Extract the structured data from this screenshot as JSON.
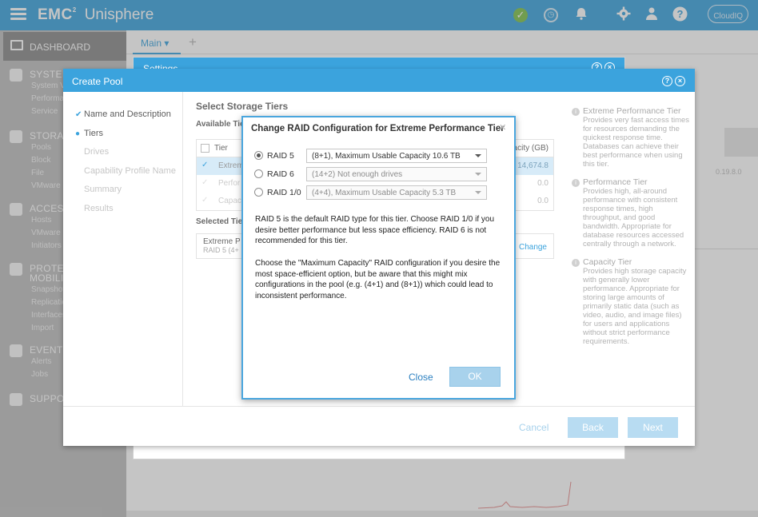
{
  "topbar": {
    "brand_emc": "EMC",
    "brand_sup": "2",
    "brand_product": "Unisphere",
    "cloudiq_label": "CloudIQ"
  },
  "sidebar": {
    "dashboard": "DASHBOARD",
    "sections": [
      {
        "head": "SYSTEM",
        "items": [
          "System V",
          "Performa",
          "Service"
        ]
      },
      {
        "head": "STORAG",
        "items": [
          "Pools",
          "Block",
          "File",
          "VMware"
        ]
      },
      {
        "head": "ACCESS",
        "items": [
          "Hosts",
          "VMware",
          "Initiators"
        ]
      },
      {
        "head": "PROTEC",
        "head2": "MOBILIT",
        "items": [
          "Snapshot",
          "Replicatio",
          "Interfaces",
          "Import"
        ]
      },
      {
        "head": "EVENTS",
        "items": [
          "Alerts",
          "Jobs"
        ]
      },
      {
        "head": "SUPPO",
        "items": []
      }
    ]
  },
  "main": {
    "tab_label": "Main",
    "add_tab": "+",
    "bg_number": "0.19.8.0"
  },
  "settings": {
    "title": "Settings"
  },
  "create_pool": {
    "title": "Create Pool",
    "steps": [
      {
        "label": "Name and Description",
        "state": "done"
      },
      {
        "label": "Tiers",
        "state": "active"
      },
      {
        "label": "Drives",
        "state": "pending"
      },
      {
        "label": "Capability Profile Name",
        "state": "pending"
      },
      {
        "label": "Summary",
        "state": "pending"
      },
      {
        "label": "Results",
        "state": "pending"
      }
    ],
    "section_title": "Select Storage Tiers",
    "available_label": "Available Tie",
    "table_header_tier": "Tier",
    "table_header_capacity": "acity (GB)",
    "rows": [
      {
        "tier": "Extrem",
        "capacity": "14,674.8"
      },
      {
        "tier": "Perfor",
        "capacity": "0.0"
      },
      {
        "tier": "Capaci",
        "capacity": "0.0"
      }
    ],
    "selected_label": "Selected Tie",
    "selected_tier": "Extreme P",
    "selected_sub": "RAID 5 (4+",
    "change_link": "Change",
    "tier_info": [
      {
        "title": "Extreme Performance Tier",
        "text": "Provides very fast access times for resources demanding the quickest response time. Databases can achieve their best performance when using this tier."
      },
      {
        "title": "Performance Tier",
        "text": "Provides high, all-around performance with consistent response times, high throughput, and good bandwidth. Appropriate for database resources accessed centrally through a network."
      },
      {
        "title": "Capacity Tier",
        "text": "Provides high storage capacity with generally lower performance. Appropriate for storing large amounts of primarily static data (such as video, audio, and image files) for users and applications without strict performance requirements."
      }
    ],
    "cancel": "Cancel",
    "back": "Back",
    "next": "Next"
  },
  "raid_dialog": {
    "title": "Change RAID Configuration for Extreme Performance Tier",
    "close_x": "×",
    "options": [
      {
        "label": "RAID 5",
        "value": "(8+1), Maximum Usable Capacity 10.6 TB",
        "checked": true,
        "disabled": false
      },
      {
        "label": "RAID 6",
        "value": "(14+2) Not enough drives",
        "checked": false,
        "disabled": true
      },
      {
        "label": "RAID 1/0",
        "value": "(4+4), Maximum Usable Capacity 5.3 TB",
        "checked": false,
        "disabled": true
      }
    ],
    "paragraph1": "RAID 5 is the default RAID type for this tier. Choose RAID 1/0 if you desire better performance but less space efficiency. RAID 6 is not recommended for this tier.",
    "paragraph2": "Choose the \"Maximum Capacity\" RAID configuration if you desire the most space-efficient option, but be aware that this might mix configurations in the pool (e.g. (4+1) and (8+1)) which could lead to inconsistent performance.",
    "close_button": "Close",
    "ok_button": "OK"
  }
}
